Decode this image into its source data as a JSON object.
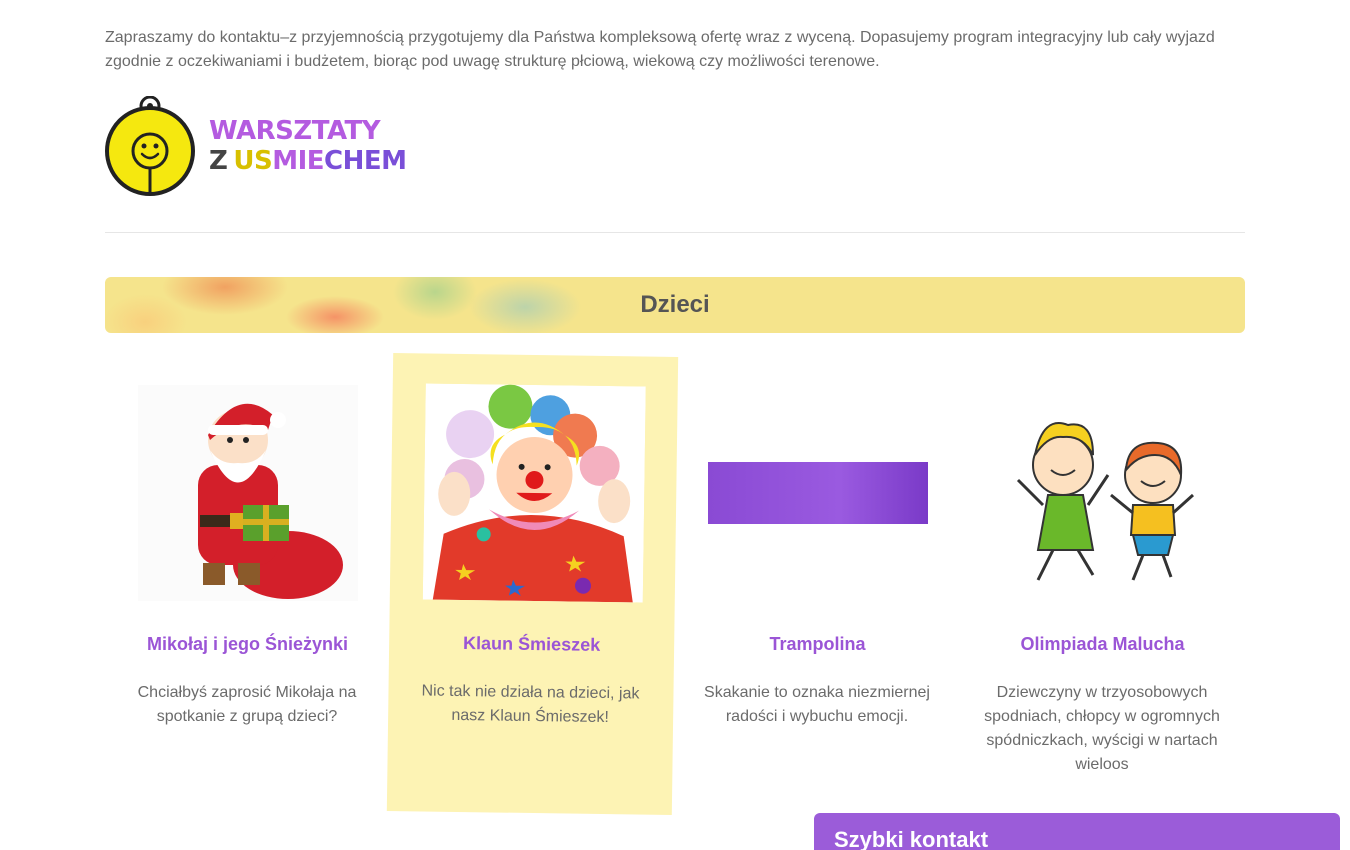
{
  "intro": {
    "text": "Zapraszamy do kontaktu–z przyjemnością przygotujemy dla Państwa kompleksową ofertę wraz z wyceną. Dopasujemy program integracyjny lub cały wyjazd zgodnie z oczekiwaniami i budżetem, biorąc pod uwagę strukturę płciową, wiekową czy możliwości terenowe."
  },
  "logo": {
    "line1": "WARSZTATY",
    "line2_z": "Z",
    "line2_us": "US",
    "line2_mie": "MIE",
    "line2_chem": "CHEM"
  },
  "section": {
    "title": "Dzieci"
  },
  "cards": [
    {
      "title": "Mikołaj i jego Śnieżynki",
      "description": "Chciałbyś zaprosić Mikołaja na spotkanie z grupą dzieci?",
      "image_icon": "santa-claus-image"
    },
    {
      "title": "Klaun Śmieszek",
      "description": "Nic tak nie działa na dzieci, jak nasz Klaun Śmieszek!",
      "image_icon": "clown-image"
    },
    {
      "title": "Trampolina",
      "description": "Skakanie to oznaka niezmiernej radości i wybuchu emocji.",
      "image_icon": "trampoline-image"
    },
    {
      "title": "Olimpiada Malucha",
      "description": "Dziewczyny w trzyosobowych spodniach, chłopcy w ogromnych spódniczkach, wyścigi w nartach wieloos",
      "image_icon": "kids-jumping-image"
    }
  ],
  "quick_contact": {
    "title": "Szybki kontakt"
  },
  "colors": {
    "accent_purple": "#9b55d6",
    "banner_yellow": "#f5e48c",
    "card_highlight": "#fdf3b4"
  }
}
